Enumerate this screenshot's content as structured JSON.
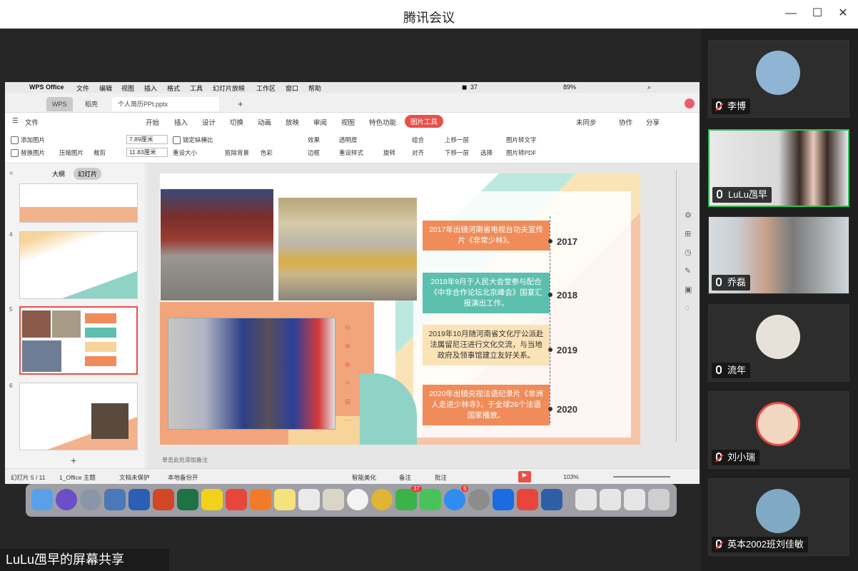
{
  "window": {
    "title": "腾讯会议"
  },
  "mac_menu": [
    "WPS Office",
    "文件",
    "编辑",
    "视图",
    "插入",
    "格式",
    "工具",
    "幻灯片放映",
    "工作区",
    "窗口",
    "帮助"
  ],
  "mac_status": {
    "badge": "37",
    "battery": "89%"
  },
  "tabs": {
    "wps": "WPS",
    "docer": "稻壳",
    "file": "个人简历PPt.pptx"
  },
  "ribbon_tabs": [
    "文件",
    "开始",
    "插入",
    "设计",
    "切换",
    "动画",
    "放映",
    "审阅",
    "视图",
    "特色功能",
    "图片工具"
  ],
  "ribbon_right": {
    "sync": "未同步",
    "collab": "协作",
    "share": "分享"
  },
  "ribbon": {
    "add_pic": "添加图片",
    "replace_pic": "替换图片",
    "compress": "压缩图片",
    "crop": "裁剪",
    "width": "7.89厘米",
    "height": "11.83厘米",
    "lock_ratio": "锁定纵横比",
    "reset_size": "重设大小",
    "remove_bg": "抠除背景",
    "color": "色彩",
    "effect": "效果",
    "border": "边框",
    "transparency": "透明度",
    "reset_style": "重设样式",
    "rotate": "旋转",
    "group": "组合",
    "align": "对齐",
    "up": "上移一层",
    "down": "下移一层",
    "select": "选择",
    "to_text": "图片转文字",
    "to_pdf": "图片转PDF"
  },
  "pane_tabs": {
    "outline": "大纲",
    "slides": "幻灯片"
  },
  "slide_numbers": [
    "4",
    "5",
    "6"
  ],
  "timeline": [
    {
      "text": "2017年出镜河南省电视台功夫宣传片《非常少林》。",
      "year": "2017",
      "color": "#ef8c5a"
    },
    {
      "text": "2018年9月于人民大会堂参与配合《中非合作论坛北京峰会》国宴汇报演出工作。",
      "year": "2018",
      "color": "#5dbfae"
    },
    {
      "text": "2019年10月随河南省文化厅公派赴法属留尼汪进行文化交流，与当地政府及领事馆建立友好关系。",
      "year": "2019",
      "color": "#f7d49a"
    },
    {
      "text": "2020年出镜央视法语纪录片《非洲人走进少林寺》，于全球26个法语国家播放。",
      "year": "2020",
      "color": "#ef8c5a"
    }
  ],
  "notes_placeholder": "单击此处添加备注",
  "statusbar": {
    "slide": "幻灯片 5 / 11",
    "theme": "1_Office 主题",
    "protect": "文档未保护",
    "backup": "本地备份开",
    "beautify": "智能美化",
    "notes": "备注",
    "comment": "批注",
    "zoom": "103%"
  },
  "dock_badges": {
    "wechat": "37",
    "appstore": "6"
  },
  "share_label": "LuLu乪早的屏幕共享",
  "participants": [
    {
      "name": "李博",
      "mic": "off"
    },
    {
      "name": "LuLu乪早",
      "mic": "on"
    },
    {
      "name": "乔磊",
      "mic": "on"
    },
    {
      "name": "流年",
      "mic": "on"
    },
    {
      "name": "刘小瑞",
      "mic": "off"
    },
    {
      "name": "英本2002班刘佳敏",
      "mic": "off"
    }
  ]
}
